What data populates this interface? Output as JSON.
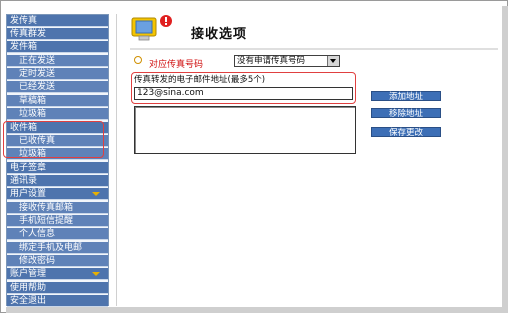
{
  "sidebar": {
    "items": [
      {
        "label": "发传真",
        "level": "top"
      },
      {
        "label": "传真群发",
        "level": "top"
      },
      {
        "label": "发件箱",
        "level": "top"
      },
      {
        "label": "正在发送",
        "level": "sub"
      },
      {
        "label": "定时发送",
        "level": "sub"
      },
      {
        "label": "已经发送",
        "level": "sub"
      },
      {
        "label": "草稿箱",
        "level": "sub"
      },
      {
        "label": "垃圾箱",
        "level": "sub"
      },
      {
        "label": "收件箱",
        "level": "top"
      },
      {
        "label": "已收传真",
        "level": "sub"
      },
      {
        "label": "垃圾箱",
        "level": "sub"
      },
      {
        "label": "电子签章",
        "level": "top"
      },
      {
        "label": "通讯录",
        "level": "top"
      },
      {
        "label": "用户设置",
        "level": "top",
        "expandable": true
      },
      {
        "label": "接收传真邮箱",
        "level": "sub"
      },
      {
        "label": "手机短信提醒",
        "level": "sub"
      },
      {
        "label": "个人信息",
        "level": "sub"
      },
      {
        "label": "绑定手机及电邮",
        "level": "sub"
      },
      {
        "label": "修改密码",
        "level": "sub"
      },
      {
        "label": "账户管理",
        "level": "top",
        "expandable": true
      },
      {
        "label": "使用帮助",
        "level": "top"
      },
      {
        "label": "安全退出",
        "level": "top"
      }
    ]
  },
  "main": {
    "title": "接收选项",
    "fax_label": "对应传真号码",
    "fax_select_value": "没有申请传真号码",
    "list_label": "传真转发的电子邮件地址(最多5个)",
    "email_value": "123@sina.com",
    "buttons": {
      "add": "添加地址",
      "remove": "移除地址",
      "save": "保存更改"
    }
  },
  "colors": {
    "nav_top": "#4e74ad",
    "nav_sub": "#5f82b8",
    "highlight_box": "#e04040",
    "button": "#3d6fb6",
    "fax_label": "#d01010"
  }
}
